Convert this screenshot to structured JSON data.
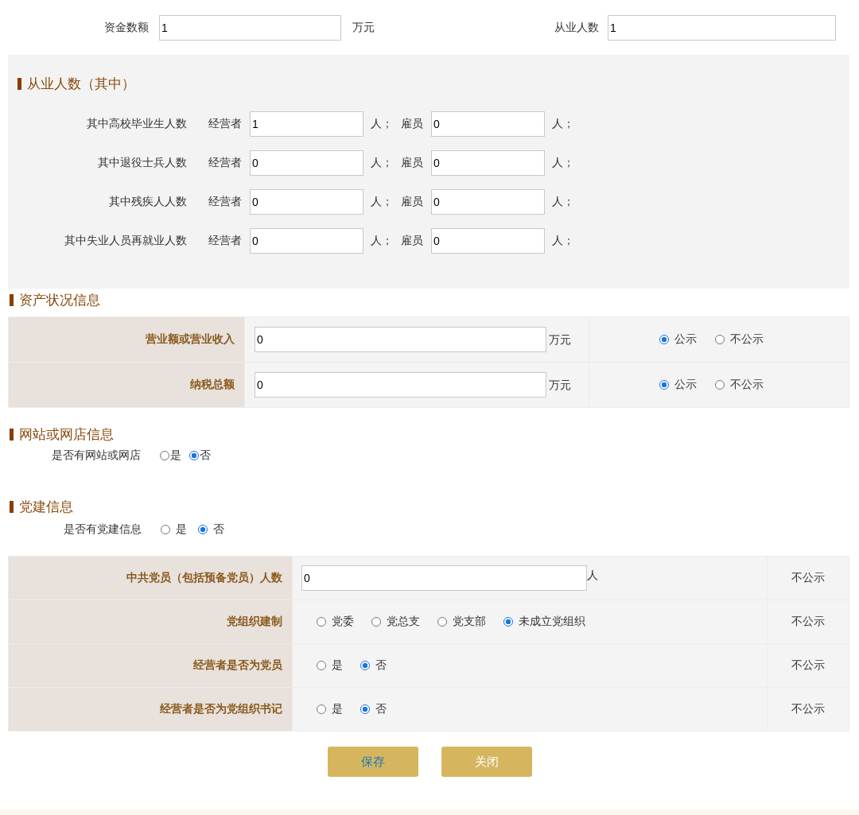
{
  "top_fields": [
    {
      "label": "资金数额",
      "value": "1",
      "unit": "万元"
    },
    {
      "label": "从业人数",
      "value": "1"
    }
  ],
  "employment": {
    "title": "从业人数（其中）",
    "rows": [
      {
        "label": "其中高校毕业生人数",
        "operator_label": "经营者",
        "operator_value": "1",
        "operator_unit": "人；",
        "employee_label": "雇员",
        "employee_value": "0",
        "employee_unit": "人；"
      },
      {
        "label": "其中退役士兵人数",
        "operator_label": "经营者",
        "operator_value": "0",
        "operator_unit": "人；",
        "employee_label": "雇员",
        "employee_value": "0",
        "employee_unit": "人；"
      },
      {
        "label": "其中残疾人人数",
        "operator_label": "经营者",
        "operator_value": "0",
        "operator_unit": "人；",
        "employee_label": "雇员",
        "employee_value": "0",
        "employee_unit": "人；"
      },
      {
        "label": "其中失业人员再就业人数",
        "operator_label": "经营者",
        "operator_value": "0",
        "operator_unit": "人；",
        "employee_label": "雇员",
        "employee_value": "0",
        "employee_unit": "人；"
      }
    ]
  },
  "assets": {
    "title": "资产状况信息",
    "rows": [
      {
        "label": "营业额或营业收入",
        "value": "0",
        "unit": "万元",
        "options": [
          {
            "label": "公示",
            "selected": true
          },
          {
            "label": "不公示",
            "selected": false
          }
        ]
      },
      {
        "label": "纳税总额",
        "value": "0",
        "unit": "万元",
        "options": [
          {
            "label": "公示",
            "selected": true
          },
          {
            "label": "不公示",
            "selected": false
          }
        ]
      }
    ]
  },
  "website": {
    "title": "网站或网店信息",
    "question": "是否有网站或网店",
    "options": [
      {
        "label": "是",
        "selected": false
      },
      {
        "label": "否",
        "selected": true
      }
    ]
  },
  "party": {
    "title": "党建信息",
    "question": "是否有党建信息",
    "options": [
      {
        "label": "是",
        "selected": false
      },
      {
        "label": "否",
        "selected": true
      }
    ],
    "rows": [
      {
        "kind": "input",
        "label": "中共党员（包括预备党员）人数",
        "value": "0",
        "unit": "人",
        "visibility": "不公示"
      },
      {
        "kind": "radio",
        "label": "党组织建制",
        "options": [
          {
            "label": "党委",
            "selected": false
          },
          {
            "label": "党总支",
            "selected": false
          },
          {
            "label": "党支部",
            "selected": false
          },
          {
            "label": "未成立党组织",
            "selected": true
          }
        ],
        "visibility": "不公示"
      },
      {
        "kind": "radio",
        "label": "经营者是否为党员",
        "options": [
          {
            "label": "是",
            "selected": false
          },
          {
            "label": "否",
            "selected": true
          }
        ],
        "visibility": "不公示"
      },
      {
        "kind": "radio",
        "label": "经营者是否为党组织书记",
        "options": [
          {
            "label": "是",
            "selected": false
          },
          {
            "label": "否",
            "selected": true
          }
        ],
        "visibility": "不公示"
      }
    ]
  },
  "buttons": [
    {
      "label": "保存",
      "kind": "primary"
    },
    {
      "label": "关闭",
      "kind": "secondary"
    }
  ]
}
